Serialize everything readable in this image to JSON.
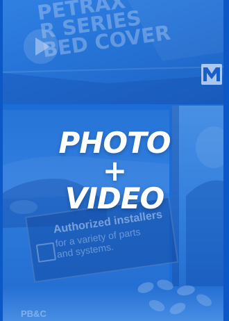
{
  "promo": {
    "product_title_lines": [
      "PETRAX",
      "R SERIES",
      "BED COVER"
    ],
    "logo_letter": "M",
    "sign_heading": "Authorized installers",
    "sign_subtext": "for a variety of parts and systems.",
    "bottom_label": "PB&C",
    "headline": {
      "line1": "PHOTO",
      "line2": "+",
      "line3": "VIDEO"
    },
    "colors": {
      "accent_blue": "#1e6fd6",
      "headline_text": "#ffffff"
    },
    "icons": [
      "play-icon",
      "m-logo-icon"
    ]
  }
}
